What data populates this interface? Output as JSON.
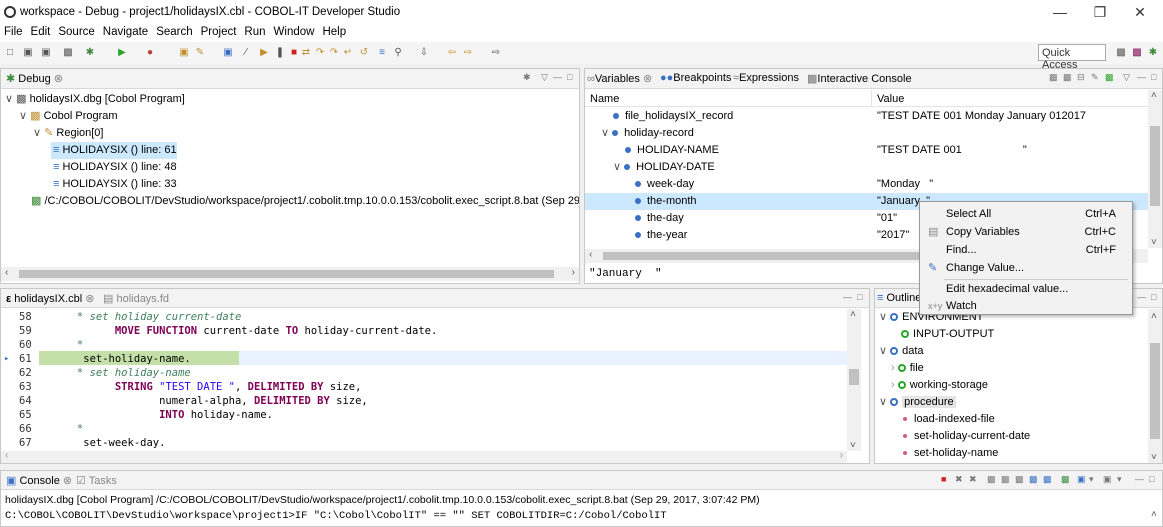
{
  "window": {
    "title": "workspace - Debug - project1/holidaysIX.cbl - COBOL-IT Developer Studio"
  },
  "menu": [
    "File",
    "Edit",
    "Source",
    "Navigate",
    "Search",
    "Project",
    "Run",
    "Window",
    "Help"
  ],
  "toolbar": {
    "quick_access": "Quick Access"
  },
  "debug": {
    "tab_label": "Debug",
    "items": [
      "holidaysIX.dbg [Cobol Program]",
      "Cobol Program",
      "Region[0]",
      "HOLIDAYSIX () line: 61",
      "HOLIDAYSIX () line: 48",
      "HOLIDAYSIX () line: 33",
      "/C:/COBOL/COBOLIT/DevStudio/workspace/project1/.cobolit.tmp.10.0.0.153/cobolit.exec_script.8.bat (Sep 29, 2("
    ]
  },
  "variables": {
    "tabs": [
      "Variables",
      "Breakpoints",
      "Expressions",
      "Interactive Console"
    ],
    "col_name": "Name",
    "col_value": "Value",
    "rows": [
      {
        "name": "file_holidaysIX_record",
        "value": "\"TEST DATE 001                    Monday   January  012017"
      },
      {
        "name": "holiday-record",
        "value": ""
      },
      {
        "name": "HOLIDAY-NAME",
        "value": "\"TEST DATE 001                    \""
      },
      {
        "name": "HOLIDAY-DATE",
        "value": ""
      },
      {
        "name": "week-day",
        "value": "\"Monday   \""
      },
      {
        "name": "the-month",
        "value": "\"January  \""
      },
      {
        "name": "the-day",
        "value": "\"01\""
      },
      {
        "name": "the-year",
        "value": "\"2017\""
      }
    ],
    "detail": "\"January  \""
  },
  "context_menu": {
    "items": [
      {
        "label": "Select All",
        "shortcut": "Ctrl+A"
      },
      {
        "label": "Copy Variables",
        "shortcut": "Ctrl+C"
      },
      {
        "label": "Find...",
        "shortcut": "Ctrl+F"
      },
      {
        "label": "Change Value...",
        "shortcut": ""
      },
      {
        "label": "Edit hexadecimal value...",
        "shortcut": ""
      },
      {
        "label": "Watch",
        "shortcut": ""
      }
    ]
  },
  "editor": {
    "tabs": [
      "holidaysIX.cbl",
      "holidays.fd"
    ],
    "lines": [
      {
        "n": "58",
        "text": "      * set holiday current-date"
      },
      {
        "n": "59",
        "text": "            MOVE FUNCTION current-date TO holiday-current-date."
      },
      {
        "n": "60",
        "text": "      *"
      },
      {
        "n": "61",
        "text": "       set-holiday-name."
      },
      {
        "n": "62",
        "text": "      * set holiday-name"
      },
      {
        "n": "63",
        "text": "            STRING \"TEST DATE \", DELIMITED BY size,"
      },
      {
        "n": "64",
        "text": "                   numeral-alpha, DELIMITED BY size,"
      },
      {
        "n": "65",
        "text": "                   INTO holiday-name."
      },
      {
        "n": "66",
        "text": "      *"
      },
      {
        "n": "67",
        "text": "       set-week-day."
      }
    ]
  },
  "outline": {
    "tab_label": "Outline",
    "items": [
      "ENVIRONMENT",
      "INPUT-OUTPUT",
      "data",
      "file",
      "working-storage",
      "procedure",
      "load-indexed-file",
      "set-holiday-current-date",
      "set-holiday-name"
    ]
  },
  "console": {
    "tabs": [
      "Console",
      "Tasks"
    ],
    "header": "holidaysIX.dbg [Cobol Program] /C:/COBOL/COBOLIT/DevStudio/workspace/project1/.cobolit.tmp.10.0.0.153/cobolit.exec_script.8.bat (Sep 29, 2017, 3:07:42 PM)",
    "line": "C:\\COBOL\\COBOLIT\\DevStudio\\workspace\\project1>IF \"C:\\Cobol\\CobolIT\" == \"\" SET COBOLITDIR=C:/Cobol/CobolIT"
  }
}
